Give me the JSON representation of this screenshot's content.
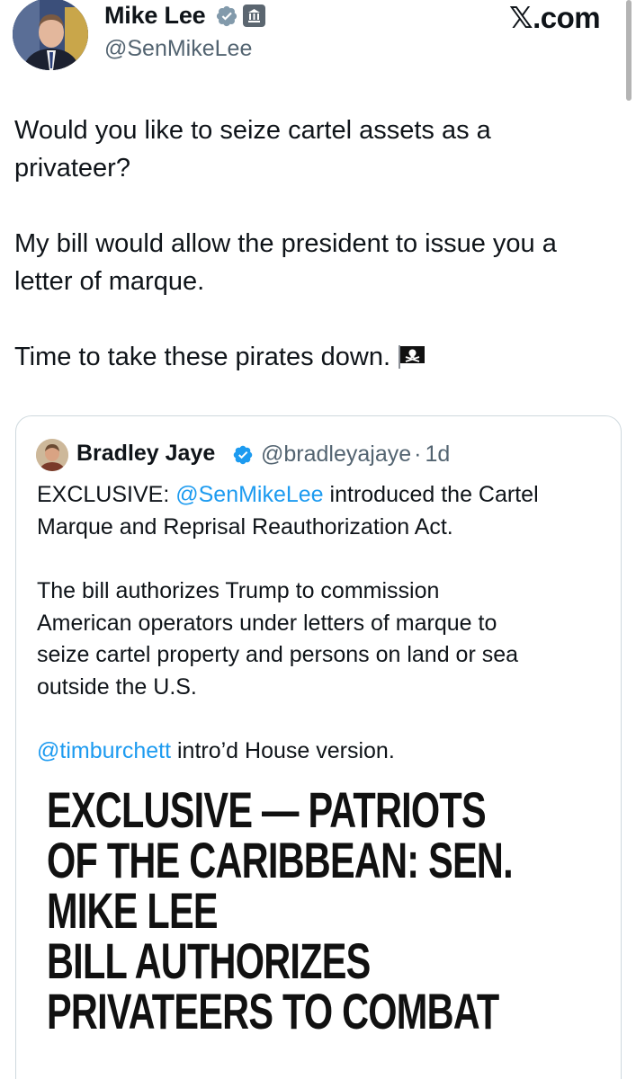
{
  "tweet": {
    "author": {
      "name": "Mike Lee",
      "handle": "@SenMikeLee",
      "avatar_icon": "senator-portrait-avatar",
      "badges": [
        "verified-badge-icon",
        "government-building-badge-icon"
      ]
    },
    "brand": "𝕏.com",
    "text_lines": [
      "Would you like to seize cartel assets as a",
      "privateer?",
      "My bill would allow the president to issue you a",
      "letter of marque.",
      "Time to take these pirates down."
    ],
    "emoji_icon": "pirate-flag-icon"
  },
  "quote": {
    "author": {
      "name": "Bradley Jaye",
      "handle": "@bradleyajaye",
      "time": "1d",
      "separator": "·"
    },
    "p1": {
      "before": "EXCLUSIVE: ",
      "mention": "@SenMikeLee",
      "after": " introduced the Cartel",
      "line2": "Marque and Reprisal Reauthorization Act."
    },
    "p2_lines": [
      "The bill authorizes Trump to commission",
      "American operators under letters of marque to",
      "seize cartel property and persons on land or sea",
      "outside the U.S."
    ],
    "p3": {
      "mention": "@timburchett",
      "after": " intro’d House version."
    },
    "article_headline_lines": [
      "EXCLUSIVE — PATRIOTS",
      "OF THE CARIBBEAN: SEN.",
      "MIKE LEE",
      "BILL AUTHORIZES",
      "PRIVATEERS TO COMBAT"
    ]
  },
  "colors": {
    "link": "#1d9bf0",
    "secondary_text": "#536471",
    "border": "#cfd9de",
    "verified": "#1d9bf0"
  }
}
